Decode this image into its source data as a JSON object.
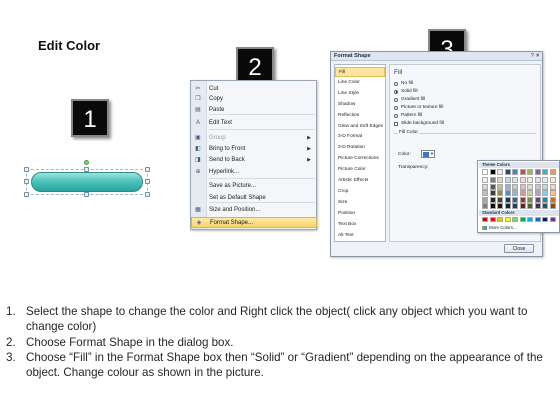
{
  "title": "Edit Color",
  "badges": [
    "1",
    "2",
    "3"
  ],
  "context_menu": {
    "items": [
      {
        "label": "Cut",
        "icon": "scissors-icon",
        "glyph": "✂"
      },
      {
        "label": "Copy",
        "icon": "copy-icon",
        "glyph": "❐"
      },
      {
        "label": "Paste",
        "icon": "paste-icon",
        "glyph": "▤"
      },
      {
        "label": "Edit Text",
        "icon": "edit-text-icon",
        "glyph": "A"
      },
      {
        "label": "Group",
        "icon": "group-icon",
        "glyph": "▣",
        "disabled": true,
        "submenu": true
      },
      {
        "label": "Bring to Front",
        "icon": "bring-to-front-icon",
        "glyph": "◧",
        "submenu": true
      },
      {
        "label": "Send to Back",
        "icon": "send-to-back-icon",
        "glyph": "◨",
        "submenu": true
      },
      {
        "label": "Hyperlink...",
        "icon": "hyperlink-icon",
        "glyph": "⊕"
      },
      {
        "label": "Save as Picture...",
        "icon": "",
        "glyph": ""
      },
      {
        "label": "Set as Default Shape",
        "icon": "",
        "glyph": ""
      },
      {
        "label": "Size and Position...",
        "icon": "size-position-icon",
        "glyph": "▦"
      },
      {
        "label": "Format Shape...",
        "icon": "format-shape-icon",
        "glyph": "◈",
        "highlighted": true
      }
    ]
  },
  "dialog": {
    "title": "Format Shape",
    "controls": "? ✕",
    "categories": [
      "Fill",
      "Line Color",
      "Line Style",
      "Shadow",
      "Reflection",
      "Glow and Soft Edges",
      "3-D Format",
      "3-D Rotation",
      "Picture Corrections",
      "Picture Color",
      "Artistic Effects",
      "Crop",
      "Size",
      "Position",
      "Text Box",
      "Alt Text"
    ],
    "selected_category": "Fill",
    "fill_heading": "Fill",
    "fill_options": [
      "No fill",
      "Solid fill",
      "Gradient fill",
      "Picture or texture fill",
      "Pattern fill",
      "Slide background fill"
    ],
    "fill_selected": "Solid fill",
    "group_label": "Fill Color",
    "color_label": "Color:",
    "transparency_label": "Transparency:",
    "selected_color": "#3e78c4",
    "picker": {
      "theme_heading": "Theme Colors",
      "standard_heading": "Standard Colors",
      "more_colors": "More Colors...",
      "theme_colors": [
        [
          "#ffffff",
          "#000000",
          "#eeece1",
          "#1f497d",
          "#4f81bd",
          "#c0504d",
          "#9bbb59",
          "#8064a2",
          "#4bacc6",
          "#f79646"
        ],
        [
          "#f2f2f2",
          "#7f7f7f",
          "#ddd9c3",
          "#c6d9f0",
          "#dbe5f1",
          "#f2dcdb",
          "#ebf1dd",
          "#e5e0ec",
          "#dbeef3",
          "#fdeada"
        ],
        [
          "#d8d8d8",
          "#595959",
          "#c4bd97",
          "#8db3e2",
          "#b8cce4",
          "#e5b9b7",
          "#d7e3bc",
          "#ccc1d9",
          "#b7dde8",
          "#fbd5b5"
        ],
        [
          "#bfbfbf",
          "#3f3f3f",
          "#938953",
          "#548dd4",
          "#95b3d7",
          "#d99694",
          "#c3d69b",
          "#b2a2c7",
          "#92cddc",
          "#fac08f"
        ],
        [
          "#a5a5a5",
          "#262626",
          "#494429",
          "#17365d",
          "#366092",
          "#953734",
          "#76923c",
          "#5f497a",
          "#31859b",
          "#e36c09"
        ],
        [
          "#7f7f7f",
          "#0c0c0c",
          "#1d1b10",
          "#0f243e",
          "#244061",
          "#632423",
          "#4f6128",
          "#3f3151",
          "#205867",
          "#974806"
        ]
      ],
      "standard_colors": [
        "#c00000",
        "#ff0000",
        "#ffc000",
        "#ffff00",
        "#92d050",
        "#00b050",
        "#00b0f0",
        "#0070c0",
        "#002060",
        "#7030a0"
      ]
    },
    "close_label": "Close"
  },
  "steps": [
    {
      "num": "1.",
      "text": "Select the shape to change the color and Right click the object( click any object which you want to change color)"
    },
    {
      "num": "2.",
      "text": "Choose Format Shape in the dialog box."
    },
    {
      "num": "3.",
      "text": "Choose “Fill” in the Format Shape box then “Solid” or “Gradient” depending on the appearance of the object. Change colour as shown in the picture."
    }
  ]
}
